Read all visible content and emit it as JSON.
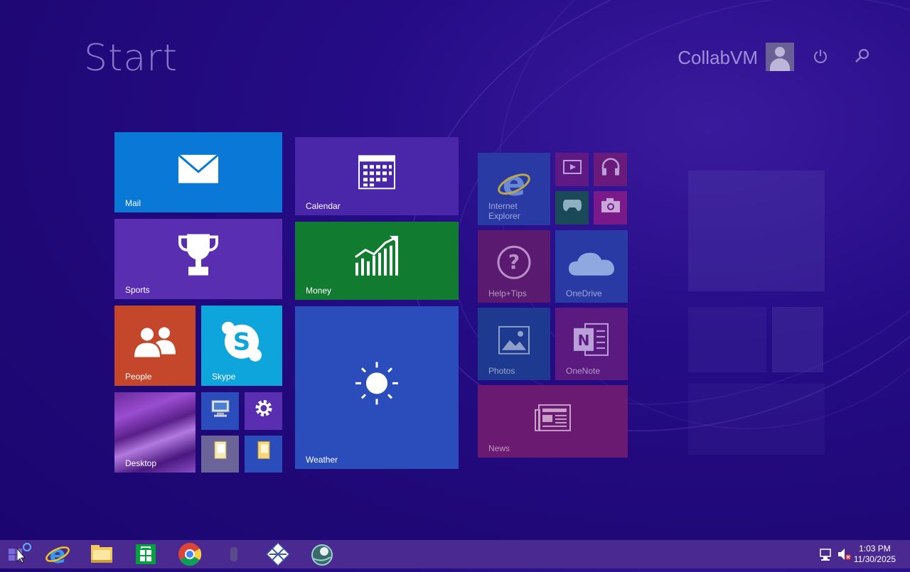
{
  "screen": {
    "title": "Start",
    "user_name": "CollabVM"
  },
  "tiles": {
    "mail": "Mail",
    "calendar": "Calendar",
    "sports": "Sports",
    "money": "Money",
    "people": "People",
    "skype": "Skype",
    "weather": "Weather",
    "desktop": "Desktop",
    "internet_explorer": "Internet Explorer",
    "help_tips": "Help+Tips",
    "onedrive": "OneDrive",
    "photos": "Photos",
    "onenote": "OneNote",
    "news": "News"
  },
  "colors": {
    "mail": "#0a78d7",
    "calendar": "#4a26a8",
    "sports": "#5a2eb0",
    "money": "#117c2f",
    "people": "#c4462b",
    "skype": "#0ea5dd",
    "weather": "#2a4dbb"
  },
  "taskbar": {
    "items": [
      "start-button",
      "internet-explorer",
      "file-explorer",
      "store",
      "chrome",
      "app-grey",
      "app-diamond",
      "app-globe"
    ]
  },
  "clock": {
    "time": "1:03 PM",
    "date": "11/30/2025"
  }
}
